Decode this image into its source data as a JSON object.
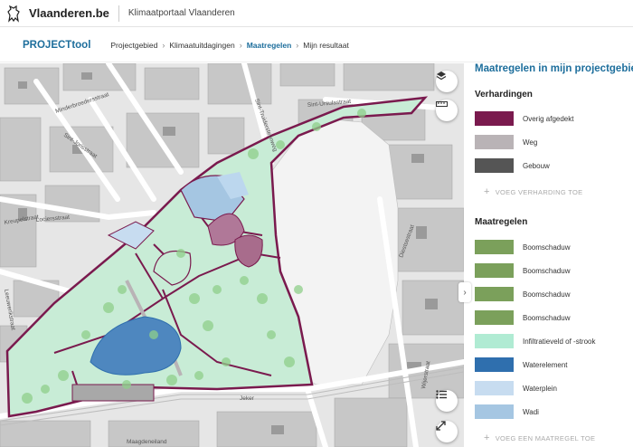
{
  "header": {
    "brand": "Vlaanderen.be",
    "portal": "Klimaatportaal Vlaanderen",
    "logo_icon": "flemish-lion-icon"
  },
  "breadcrumb": {
    "title": "PROJECTtool",
    "items": [
      {
        "label": "Projectgebied",
        "active": false
      },
      {
        "label": "Klimaatuitdagingen",
        "active": false
      },
      {
        "label": "Maatregelen",
        "active": true
      },
      {
        "label": "Mijn resultaat",
        "active": false
      }
    ]
  },
  "map": {
    "street_labels": [
      "Sint-Ursulastraat",
      "Minderbroedersstraat",
      "Sint-Jorisstraat",
      "Lociersstraat",
      "Kreupelstraat",
      "Jeker",
      "Maagdeneiland",
      "Wijerstraat",
      "Diestsestraat",
      "Leeuwerikstraat",
      "Sint-Truidersteenweg"
    ],
    "buttons": {
      "layers_icon": "layers-icon",
      "measure_icon": "ruler-icon",
      "list_icon": "list-icon",
      "fullscreen_icon": "expand-icon"
    }
  },
  "sidebar": {
    "title": "Maatregelen in mijn projectgebied",
    "collapse_icon": "chevron-right-icon",
    "verhardingen": {
      "heading": "Verhardingen",
      "items": [
        {
          "label": "Overig afgedekt",
          "color": "#7a1a4e"
        },
        {
          "label": "Weg",
          "color": "#b9b3b6"
        },
        {
          "label": "Gebouw",
          "color": "#555555"
        }
      ],
      "add_label": "VOEG VERHARDING TOE"
    },
    "maatregelen": {
      "heading": "Maatregelen",
      "items": [
        {
          "label": "Boomschaduw",
          "color": "#7ba05b"
        },
        {
          "label": "Boomschaduw",
          "color": "#7ba05b"
        },
        {
          "label": "Boomschaduw",
          "color": "#7ba05b"
        },
        {
          "label": "Boomschaduw",
          "color": "#7ba05b"
        },
        {
          "label": "Infiltratieveld of -strook",
          "color": "#b0ebd3"
        },
        {
          "label": "Waterelement",
          "color": "#2f6fae"
        },
        {
          "label": "Waterplein",
          "color": "#c7dcf0"
        },
        {
          "label": "Wadi",
          "color": "#a5c6e2"
        }
      ],
      "add_label": "VOEG EEN MAATREGEL TOE"
    }
  }
}
